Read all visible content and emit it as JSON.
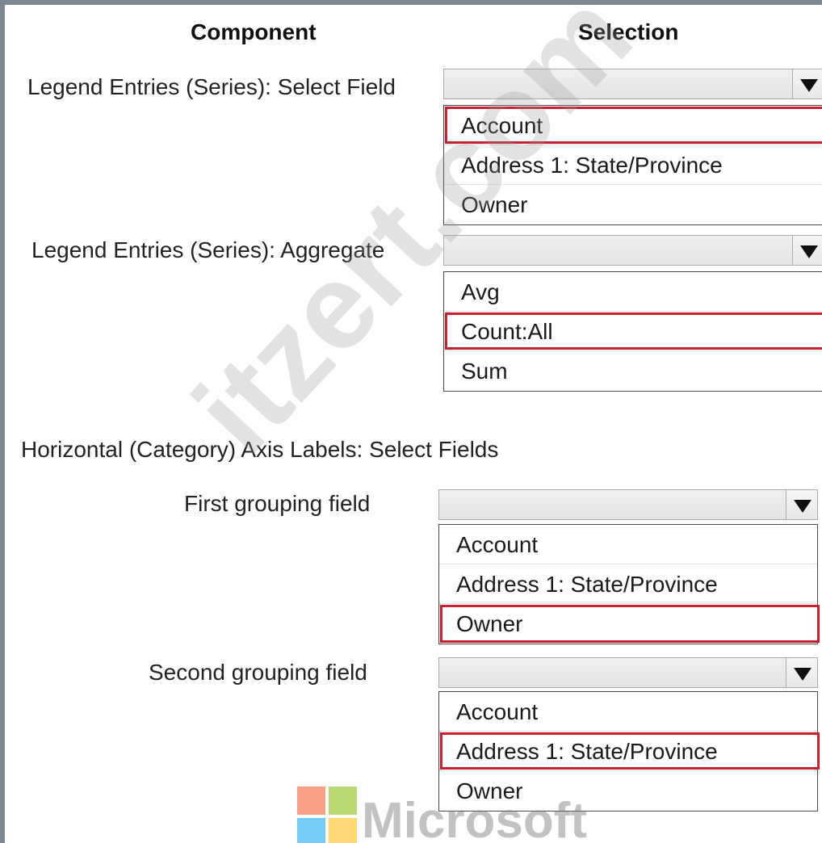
{
  "headers": {
    "component": "Component",
    "selection": "Selection"
  },
  "rows": [
    {
      "label": "Legend Entries (Series): Select Field",
      "selected_value": "",
      "options": [
        "Account",
        "Address 1: State/Province",
        "Owner"
      ],
      "highlighted": "Account"
    },
    {
      "label": "Legend Entries (Series): Aggregate",
      "selected_value": "",
      "options": [
        "Avg",
        "Count:All",
        "Sum"
      ],
      "highlighted": "Count:All"
    },
    {
      "label": "First grouping field",
      "selected_value": "",
      "options": [
        "Account",
        "Address 1: State/Province",
        "Owner"
      ],
      "highlighted": "Owner"
    },
    {
      "label": "Second grouping field",
      "selected_value": "",
      "options": [
        "Account",
        "Address 1: State/Province",
        "Owner"
      ],
      "highlighted": "Address 1: State/Province"
    }
  ],
  "section_heading": "Horizontal (Category) Axis Labels: Select Fields",
  "highlight_color": "#c8202f",
  "watermark": "itzert.com",
  "logo": {
    "wordmark": "Microsoft",
    "colors": [
      "#f25022",
      "#7fba00",
      "#00a4ef",
      "#ffb900"
    ]
  }
}
